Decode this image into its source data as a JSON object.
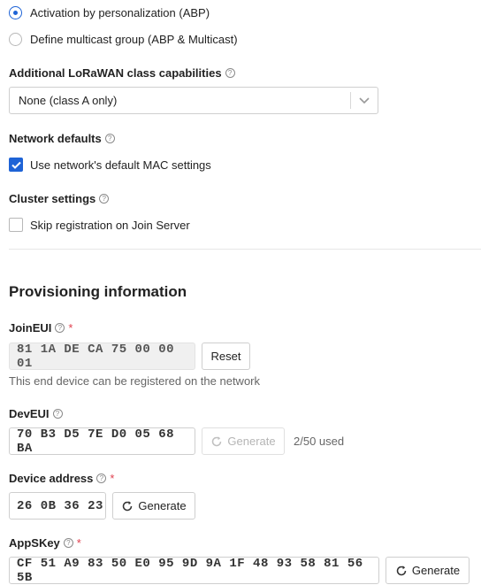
{
  "activation": {
    "options": [
      {
        "label": "Activation by personalization (ABP)",
        "selected": true
      },
      {
        "label": "Define multicast group (ABP & Multicast)",
        "selected": false
      }
    ]
  },
  "class_capabilities": {
    "label": "Additional LoRaWAN class capabilities",
    "value": "None (class A only)"
  },
  "network_defaults": {
    "label": "Network defaults",
    "checkbox_label": "Use network's default MAC settings",
    "checked": true
  },
  "cluster_settings": {
    "label": "Cluster settings",
    "checkbox_label": "Skip registration on Join Server",
    "checked": false
  },
  "provisioning": {
    "title": "Provisioning information",
    "join_eui": {
      "label": "JoinEUI",
      "required_mark": "*",
      "value": "81 1A DE CA 75 00 00 01",
      "button": "Reset",
      "hint": "This end device can be registered on the network"
    },
    "dev_eui": {
      "label": "DevEUI",
      "value": "70 B3 D5 7E D0 05 68 BA",
      "button": "Generate",
      "usage": "2/50 used"
    },
    "device_address": {
      "label": "Device address",
      "required_mark": "*",
      "value": "26 0B 36 23",
      "button": "Generate"
    },
    "app_skey": {
      "label": "AppSKey",
      "required_mark": "*",
      "value": "CF 51 A9 83 50 E0 95 9D 9A 1F 48 93 58 81 56 5B",
      "button": "Generate"
    }
  },
  "icons": {
    "help": "help-circle-icon",
    "refresh": "refresh-icon",
    "chevron": "chevron-down-icon",
    "check": "checkmark-icon"
  },
  "colors": {
    "accent": "#1e63d6",
    "required": "#e0414f"
  }
}
